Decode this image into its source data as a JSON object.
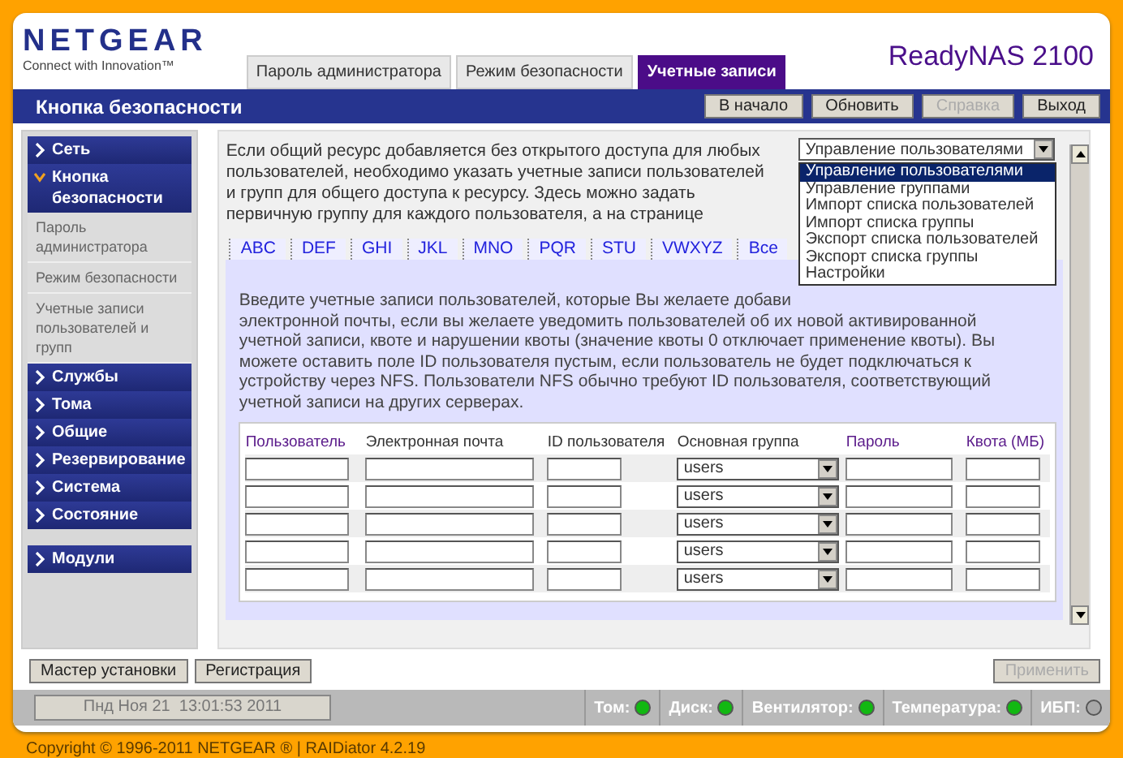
{
  "header": {
    "logo": "NETGEAR",
    "tagline": "Connect with Innovation™",
    "product": "ReadyNAS 2100"
  },
  "tabs": [
    {
      "label": "Пароль администратора",
      "selected": false
    },
    {
      "label": "Режим безопасности",
      "selected": false
    },
    {
      "label": "Учетные записи",
      "selected": true
    }
  ],
  "title": "Кнопка безопасности",
  "header_buttons": [
    {
      "label": "В начало",
      "disabled": false
    },
    {
      "label": "Обновить",
      "disabled": false
    },
    {
      "label": "Справка",
      "disabled": true
    },
    {
      "label": "Выход",
      "disabled": false
    }
  ],
  "sidebar_groups": [
    {
      "items": [
        {
          "label": "Сеть",
          "expanded": false
        },
        {
          "label": "Кнопка безопасности",
          "expanded": true,
          "children": [
            {
              "label": "Пароль администратора"
            },
            {
              "label": "Режим безопасности"
            },
            {
              "label": "Учетные записи пользователей и групп"
            }
          ]
        },
        {
          "label": "Службы",
          "expanded": false
        },
        {
          "label": "Тома",
          "expanded": false
        },
        {
          "label": "Общие",
          "expanded": false
        },
        {
          "label": "Резервирование",
          "expanded": false
        },
        {
          "label": "Система",
          "expanded": false
        },
        {
          "label": "Состояние",
          "expanded": false
        }
      ]
    },
    {
      "items": [
        {
          "label": "Модули",
          "expanded": false
        }
      ]
    }
  ],
  "intro_lines": [
    "Если общий ресурс добавляется без открытого доступа для любых",
    "пользователей, необходимо указать учетные записи пользователей",
    "и групп для общего доступа к ресурсу. Здесь можно задать",
    "первичную группу для каждого пользователя, а на странице"
  ],
  "view_select": {
    "value": "Управление пользователями",
    "options": [
      {
        "label": "Управление пользователями",
        "selected": true
      },
      {
        "label": "Управление группами",
        "selected": false
      },
      {
        "label": "Импорт списка пользователей",
        "selected": false
      },
      {
        "label": "Импорт списка группы",
        "selected": false
      },
      {
        "label": "Экспорт списка пользователей",
        "selected": false
      },
      {
        "label": "Экспорт списка группы",
        "selected": false
      },
      {
        "label": "Настройки",
        "selected": false
      }
    ]
  },
  "letter_tabs": [
    "ABC",
    "DEF",
    "GHI",
    "JKL",
    "MNO",
    "PQR",
    "STU",
    "VWXYZ",
    "Все"
  ],
  "instruction_lines": [
    "Введите учетные записи пользователей, которые Вы желаете добави",
    "электронной почты, если вы желаете уведомить пользователей об их новой активированной",
    "учетной записи, квоте и нарушении квоты (значение квоты 0 отключает применение квоты). Вы",
    "можете оставить поле ID пользователя пустым, если пользователь не будет подключаться к",
    "устройству через NFS. Пользователи NFS обычно требуют ID пользователя, соответствующий",
    "учетной записи на других серверах."
  ],
  "user_table": {
    "columns": [
      {
        "label": "Пользователь",
        "required": true
      },
      {
        "label": "Электронная почта",
        "required": false
      },
      {
        "label": "ID пользователя",
        "required": false
      },
      {
        "label": "Основная группа",
        "required": false
      },
      {
        "label": "Пароль",
        "required": true
      },
      {
        "label": "Квота (МБ)",
        "required": true
      }
    ],
    "rows": [
      {
        "group": "users"
      },
      {
        "group": "users"
      },
      {
        "group": "users"
      },
      {
        "group": "users"
      },
      {
        "group": "users"
      }
    ]
  },
  "footer_buttons": [
    {
      "label": "Мастер установки",
      "disabled": false
    },
    {
      "label": "Регистрация",
      "disabled": false
    }
  ],
  "apply_button": {
    "label": "Применить",
    "disabled": true
  },
  "status_bar": {
    "datetime": "Пнд Ноя 21  13:01:53 2011",
    "indicators": [
      {
        "label": "Том:",
        "color": "#12b812"
      },
      {
        "label": "Диск:",
        "color": "#12b812"
      },
      {
        "label": "Вентилятор:",
        "color": "#12b812"
      },
      {
        "label": "Температура:",
        "color": "#12b812"
      },
      {
        "label": "ИБП:",
        "color": "#a8a8a8"
      }
    ]
  },
  "copyright": "Copyright © 1996-2011 NETGEAR ® | RAIDiator 4.2.19"
}
